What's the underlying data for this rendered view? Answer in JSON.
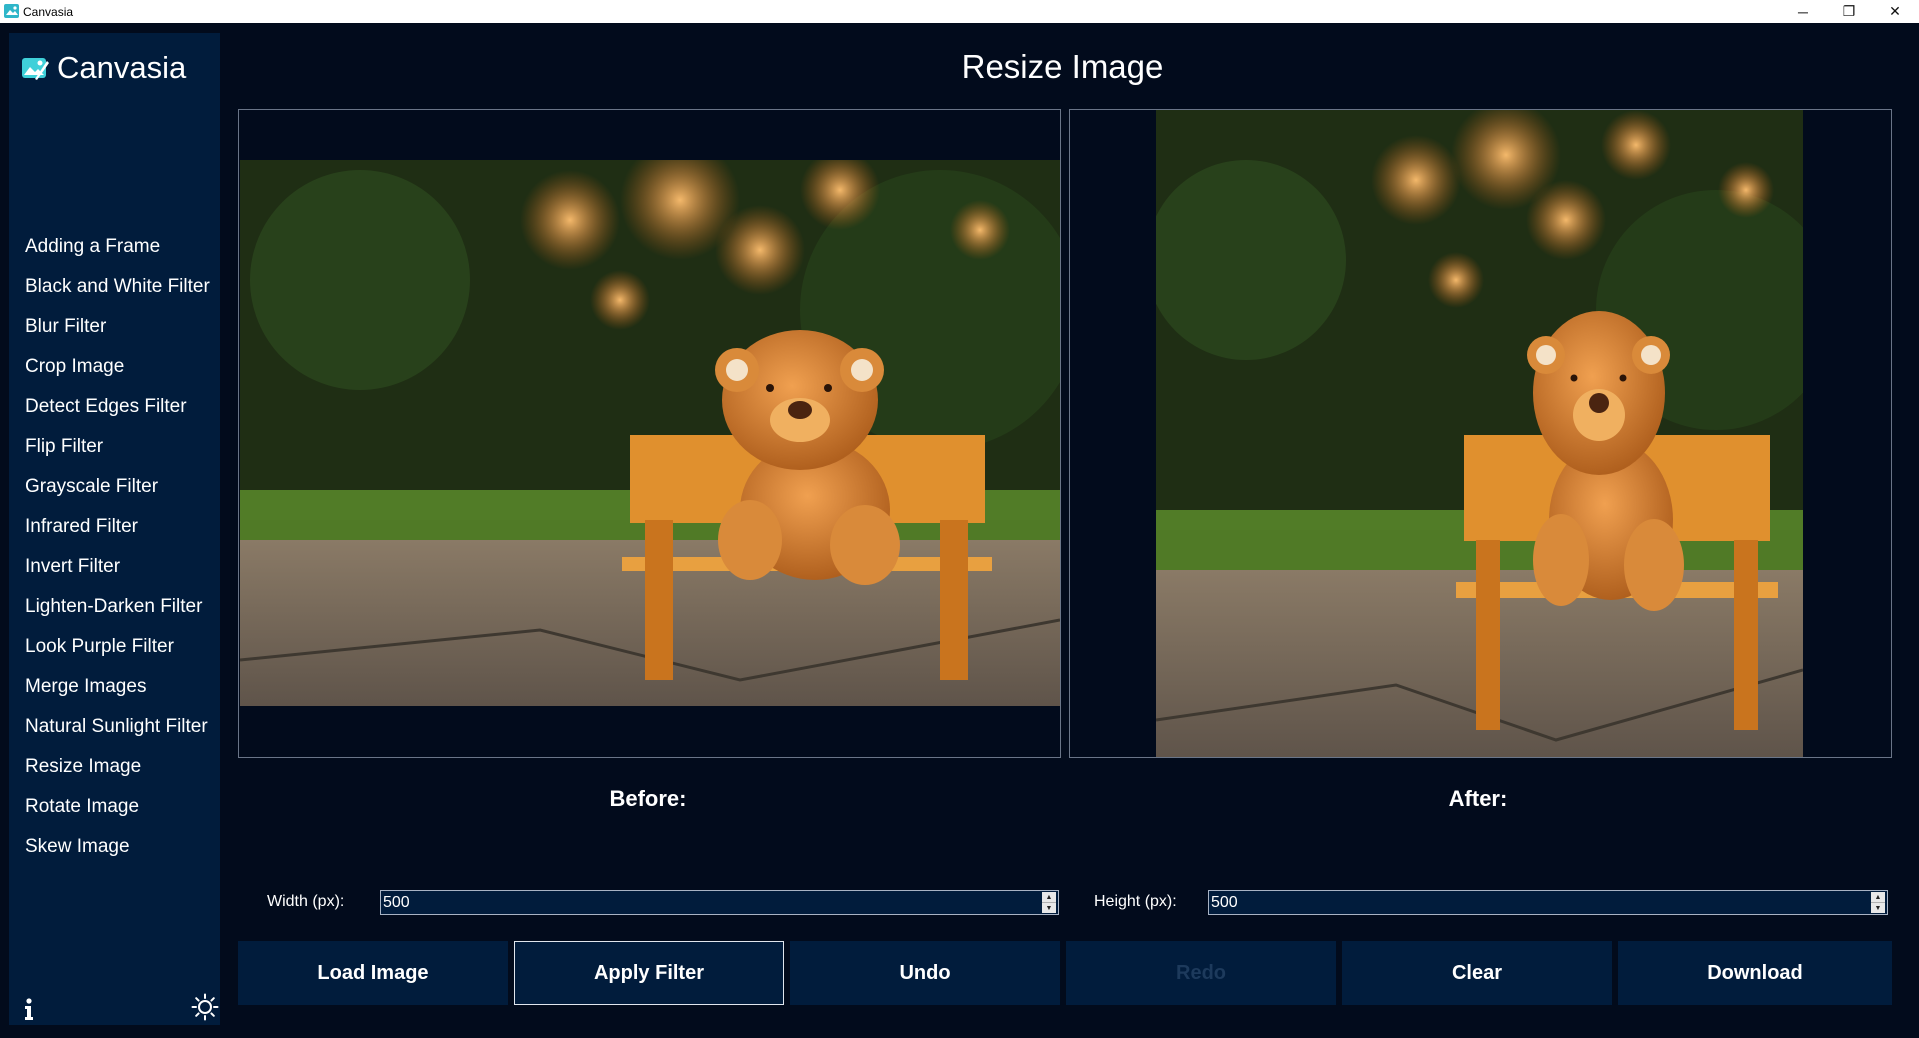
{
  "window": {
    "title": "Canvasia",
    "minimize": "─",
    "maximize": "❐",
    "close": "✕"
  },
  "sidebar": {
    "brand": "Canvasia",
    "items": [
      {
        "label": "Adding a Frame"
      },
      {
        "label": "Black and White Filter"
      },
      {
        "label": "Blur Filter"
      },
      {
        "label": "Crop Image"
      },
      {
        "label": "Detect Edges Filter"
      },
      {
        "label": "Flip Filter"
      },
      {
        "label": "Grayscale Filter"
      },
      {
        "label": "Infrared Filter"
      },
      {
        "label": "Invert Filter"
      },
      {
        "label": "Lighten-Darken Filter"
      },
      {
        "label": "Look Purple Filter"
      },
      {
        "label": "Merge Images"
      },
      {
        "label": "Natural Sunlight Filter"
      },
      {
        "label": "Resize Image"
      },
      {
        "label": "Rotate Image"
      },
      {
        "label": "Skew Image"
      }
    ],
    "info_icon": "info-icon",
    "theme_icon": "sun-icon"
  },
  "main": {
    "title": "Resize Image",
    "before_caption": "Before:",
    "after_caption": "After:",
    "width_label": "Width (px):",
    "width_value": "500",
    "height_label": "Height (px):",
    "height_value": "500"
  },
  "buttons": {
    "load": "Load Image",
    "apply": "Apply Filter",
    "undo": "Undo",
    "redo": "Redo",
    "clear": "Clear",
    "download": "Download"
  },
  "colors": {
    "background": "#020b1c",
    "sidebar": "#011c3c",
    "button": "#011c3c",
    "disabled_text": "#1d3a5c"
  }
}
